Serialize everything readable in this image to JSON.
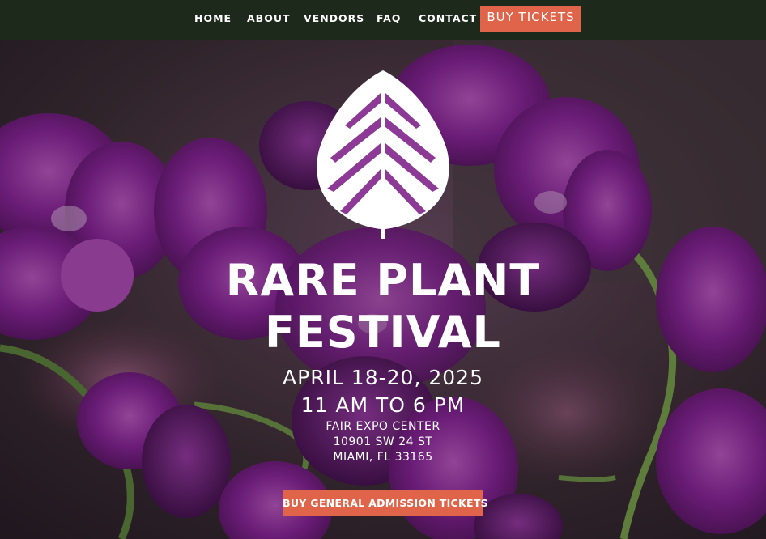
{
  "nav": {
    "items": [
      {
        "label": "HOME"
      },
      {
        "label": "ABOUT"
      },
      {
        "label": "VENDORS"
      },
      {
        "label": "FAQ"
      },
      {
        "label": "CONTACT"
      }
    ],
    "cta_label": "BUY TICKETS"
  },
  "hero": {
    "logo_icon": "monstera-leaf-icon",
    "background": "purple-orchids-photo",
    "title_line_1": "RARE PLANT",
    "title_line_2": "FESTIVAL",
    "dates": "APRIL 18-20, 2025",
    "hours": "11 AM TO 6 PM",
    "venue": "FAIR EXPO CENTER",
    "street": "10901 SW 24 ST",
    "city": "MIAMI, FL 33165",
    "cta_label": "BUY GENERAL ADMISSION TICKETS"
  },
  "colors": {
    "nav_background": "#1d2a1b",
    "accent": "#e0644a",
    "text": "#ffffff",
    "orchid_purple": "#7a1f86"
  }
}
